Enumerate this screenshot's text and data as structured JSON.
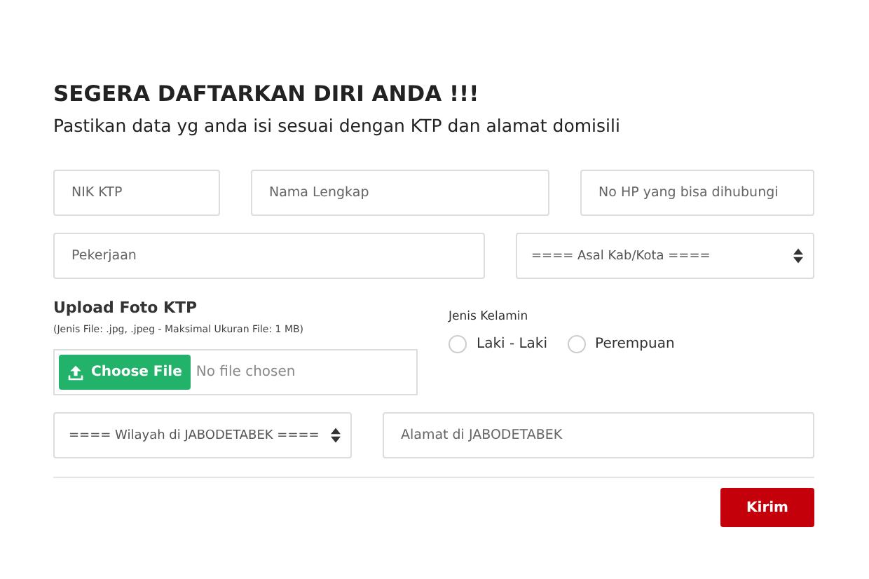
{
  "heading": "SEGERA DAFTARKAN DIRI ANDA !!!",
  "subheading": "Pastikan data yg anda isi sesuai dengan KTP dan alamat domisili",
  "row_1": [
    {
      "kind": "input",
      "placeholder": "NIK KTP"
    },
    {
      "kind": "input",
      "placeholder": "Nama Lengkap"
    },
    {
      "kind": "input",
      "placeholder": "No HP yang bisa dihubungi"
    }
  ],
  "row_2": [
    {
      "kind": "input",
      "placeholder": "Pekerjaan"
    },
    {
      "kind": "select",
      "placeholder": "==== Asal Kab/Kota ===="
    }
  ],
  "upload": {
    "label": "Upload Foto KTP",
    "hint": "(Jenis File: .jpg, .jpeg - Maksimal Ukuran File: 1 MB)",
    "button": "Choose File",
    "status": "No file chosen"
  },
  "gender": {
    "label": "Jenis Kelamin",
    "options": [
      {
        "label": "Laki - Laki",
        "selected": false
      },
      {
        "label": "Perempuan",
        "selected": false
      }
    ]
  },
  "row_3": [
    {
      "kind": "select",
      "placeholder": "==== Wilayah di JABODETABEK ===="
    },
    {
      "kind": "input",
      "placeholder": "Alamat di JABODETABEK"
    }
  ],
  "submit": "Kirim"
}
